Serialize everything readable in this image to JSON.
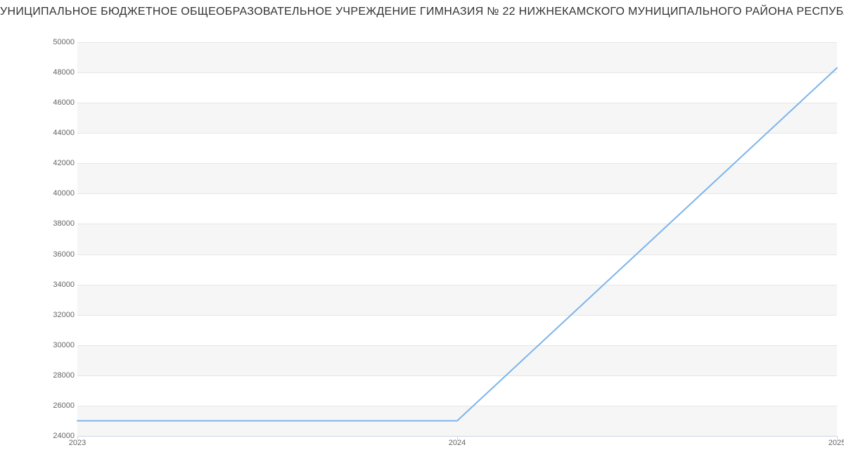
{
  "title": "УНИЦИПАЛЬНОЕ БЮДЖЕТНОЕ ОБЩЕОБРАЗОВАТЕЛЬНОЕ УЧРЕЖДЕНИЕ ГИМНАЗИЯ № 22 НИЖНЕКАМСКОГО МУНИЦИПАЛЬНОГО РАЙОНА РЕСПУБЛИКИ ТАТАРСТАН | Данны",
  "chart_data": {
    "type": "line",
    "categories": [
      "2023",
      "2024",
      "2025"
    ],
    "values": [
      25000,
      25000,
      48300
    ],
    "title": "УНИЦИПАЛЬНОЕ БЮДЖЕТНОЕ ОБЩЕОБРАЗОВАТЕЛЬНОЕ УЧРЕЖДЕНИЕ ГИМНАЗИЯ № 22 НИЖНЕКАМСКОГО МУНИЦИПАЛЬНОГО РАЙОНА РЕСПУБЛИКИ ТАТАРСТАН | Данны",
    "xlabel": "",
    "ylabel": "",
    "ylim": [
      24000,
      50000
    ],
    "y_ticks": [
      24000,
      26000,
      28000,
      30000,
      32000,
      34000,
      36000,
      38000,
      40000,
      42000,
      44000,
      46000,
      48000,
      50000
    ]
  },
  "y_ticks": {
    "t0": "24000",
    "t1": "26000",
    "t2": "28000",
    "t3": "30000",
    "t4": "32000",
    "t5": "34000",
    "t6": "36000",
    "t7": "38000",
    "t8": "40000",
    "t9": "42000",
    "t10": "44000",
    "t11": "46000",
    "t12": "48000",
    "t13": "50000"
  },
  "x_ticks": {
    "x0": "2023",
    "x1": "2024",
    "x2": "2025"
  }
}
